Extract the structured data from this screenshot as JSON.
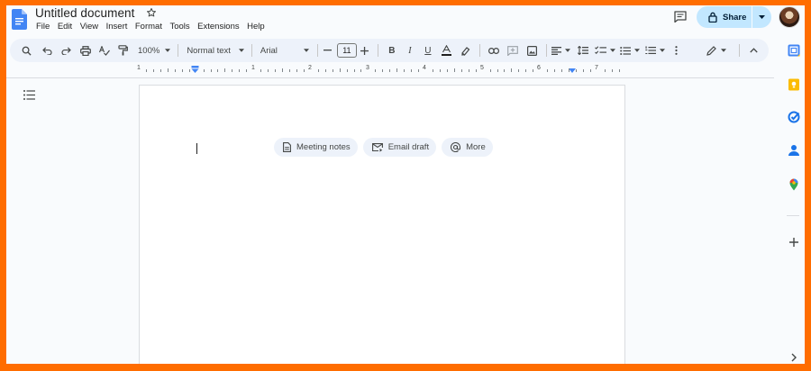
{
  "document": {
    "title": "Untitled document"
  },
  "menu": [
    "File",
    "Edit",
    "View",
    "Insert",
    "Format",
    "Tools",
    "Extensions",
    "Help"
  ],
  "header": {
    "share_label": "Share"
  },
  "toolbar": {
    "zoom": "100%",
    "style": "Normal text",
    "font": "Arial",
    "font_size": "11"
  },
  "ruler": {
    "numbers": [
      "1",
      "1",
      "2",
      "3",
      "4",
      "5",
      "6",
      "7"
    ]
  },
  "chips": [
    {
      "label": "Meeting notes",
      "icon": "document-icon"
    },
    {
      "label": "Email draft",
      "icon": "email-icon"
    },
    {
      "label": "More",
      "icon": "at-sign-icon"
    }
  ],
  "colors": {
    "frame": "#ff6d00",
    "share_bg": "#c2e7ff",
    "toolbar_bg": "#edf2fa",
    "docs_blue": "#4285f4"
  }
}
